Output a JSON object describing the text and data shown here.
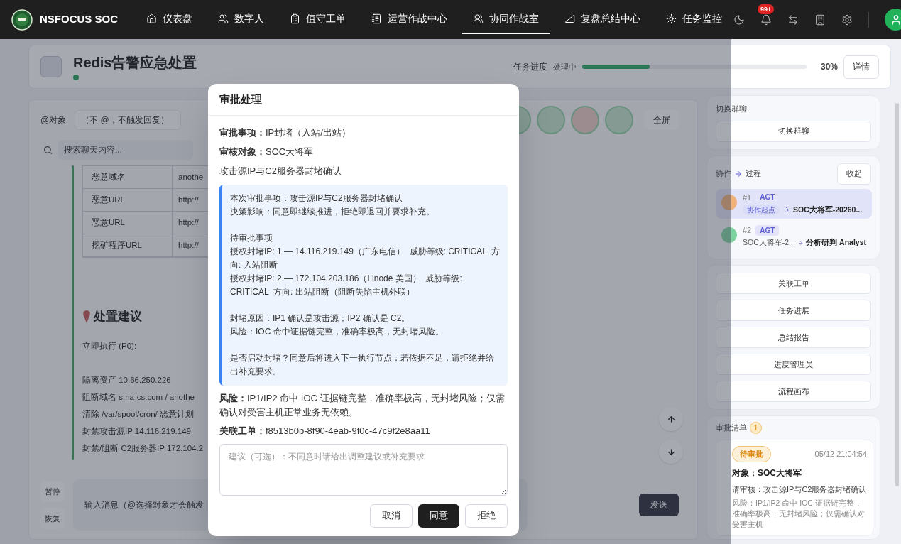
{
  "brand": "NSFOCUS SOC",
  "nav": [
    {
      "label": "仪表盘",
      "selected": false
    },
    {
      "label": "数字人",
      "selected": false
    },
    {
      "label": "值守工单",
      "selected": false
    },
    {
      "label": "运营作战中心",
      "selected": false
    },
    {
      "label": "协同作战室",
      "selected": true
    },
    {
      "label": "复盘总结中心",
      "selected": false
    },
    {
      "label": "任务监控",
      "selected": false
    }
  ],
  "notification_badge": "99+",
  "task": {
    "title": "Redis告警应急处置",
    "progress_label": "任务进度",
    "progress_status": "处理中",
    "level": 0.3,
    "percent": "30%",
    "details_button": "详情"
  },
  "chat": {
    "mention_label": "@对象",
    "mention_select": "（不 @，不触发回复）",
    "fullscreen": "全屏",
    "search_placeholder": "搜索聊天内容...",
    "side_buttons": [
      "暂停",
      "恢复"
    ],
    "input_placeholder": "输入消息（@选择对象才会触发",
    "table_rows": [
      [
        "恶意域名",
        "anothe"
      ],
      [
        "恶意URL",
        "http://"
      ],
      [
        "恶意URL",
        "http://"
      ],
      [
        "挖矿程序URL",
        "http://"
      ]
    ],
    "section_title": "处置建议",
    "lead": "立即执行 (P0):",
    "lines": [
      "隔离资产 10.66.250.226",
      "阻断域名 s.na-cs.com / anothe",
      "清除 /var/spool/cron/ 恶意计划",
      "封禁攻击源IP 14.116.219.149",
      "封禁/阻断 C2服务器IP 172.104.2"
    ],
    "send": "发送"
  },
  "sidebar": {
    "switch_label": "切换群聊",
    "switch_button": "切换群聊",
    "flow_title_a": "协作",
    "flow_title_b": "过程",
    "collapse": "收起",
    "flow": [
      {
        "index": "#1",
        "tag": "AGT",
        "from": "协作起点",
        "kind": "chip",
        "to": "SOC大将军-20260...",
        "selected": true,
        "color": "#f0b27a"
      },
      {
        "index": "#2",
        "tag": "AGT",
        "from": "SOC大将军-2...",
        "kind": "text",
        "to": "分析研判 Analyst",
        "selected": false,
        "color": "#7dd3a0"
      }
    ],
    "actions": [
      "关联工单",
      "任务进展",
      "总结报告",
      "进度管理员",
      "流程画布"
    ],
    "approvals_title": "审批清单",
    "approvals_count": "1",
    "approval": {
      "status": "待审批",
      "time": "05/12 21:04:54",
      "object": "对象：SOC大将军",
      "review": "请审核：攻击源IP与C2服务器封堵确认",
      "risk": "风险：IP1/IP2 命中 IOC 证据链完整，准确率极高，无封堵风险；仅需确认对受害主机"
    }
  },
  "modal": {
    "title": "审批处理",
    "fields": [
      {
        "label": "审批事项：",
        "value": "IP封堵（入站/出站）"
      },
      {
        "label": "审核对象：",
        "value": "SOC大将军"
      }
    ],
    "subject": "攻击源IP与C2服务器封堵确认",
    "quote": [
      [
        "本次审批事项：攻击源IP与C2服务器封堵确认",
        "决策影响：同意即继续推进，拒绝即退回并要求补充。"
      ],
      [
        "待审批事项",
        "授权封堵IP: 1 — 14.116.219.149（广东电信）  威胁等级: CRITICAL  方向: 入站阻断",
        "授权封堵IP: 2 — 172.104.203.186（Linode 美国）  威胁等级: CRITICAL  方向: 出站阻断（阻断失陷主机外联）"
      ],
      [
        "封堵原因：IP1 确认是攻击源；IP2 确认是 C2。",
        "风险：IOC 命中证据链完整，准确率极高，无封堵风险。"
      ],
      [
        "是否启动封堵？同意后将进入下一执行节点；若依据不足，请拒绝并给出补充要求。"
      ]
    ],
    "risk_label": "风险：",
    "risk": "IP1/IP2 命中 IOC 证据链完整，准确率极高，无封堵风险；仅需确认对受害主机正常业务无依赖。",
    "ticket_label": "关联工单：",
    "ticket": "f8513b0b-8f90-4eab-9f0c-47c9f2e8aa11",
    "placeholder": "建议（可选）：不同意时请给出调整建议或补充要求",
    "buttons": [
      {
        "label": "取消",
        "kind": "secondary"
      },
      {
        "label": "同意",
        "kind": "primary"
      },
      {
        "label": "拒绝",
        "kind": "secondary"
      }
    ]
  }
}
